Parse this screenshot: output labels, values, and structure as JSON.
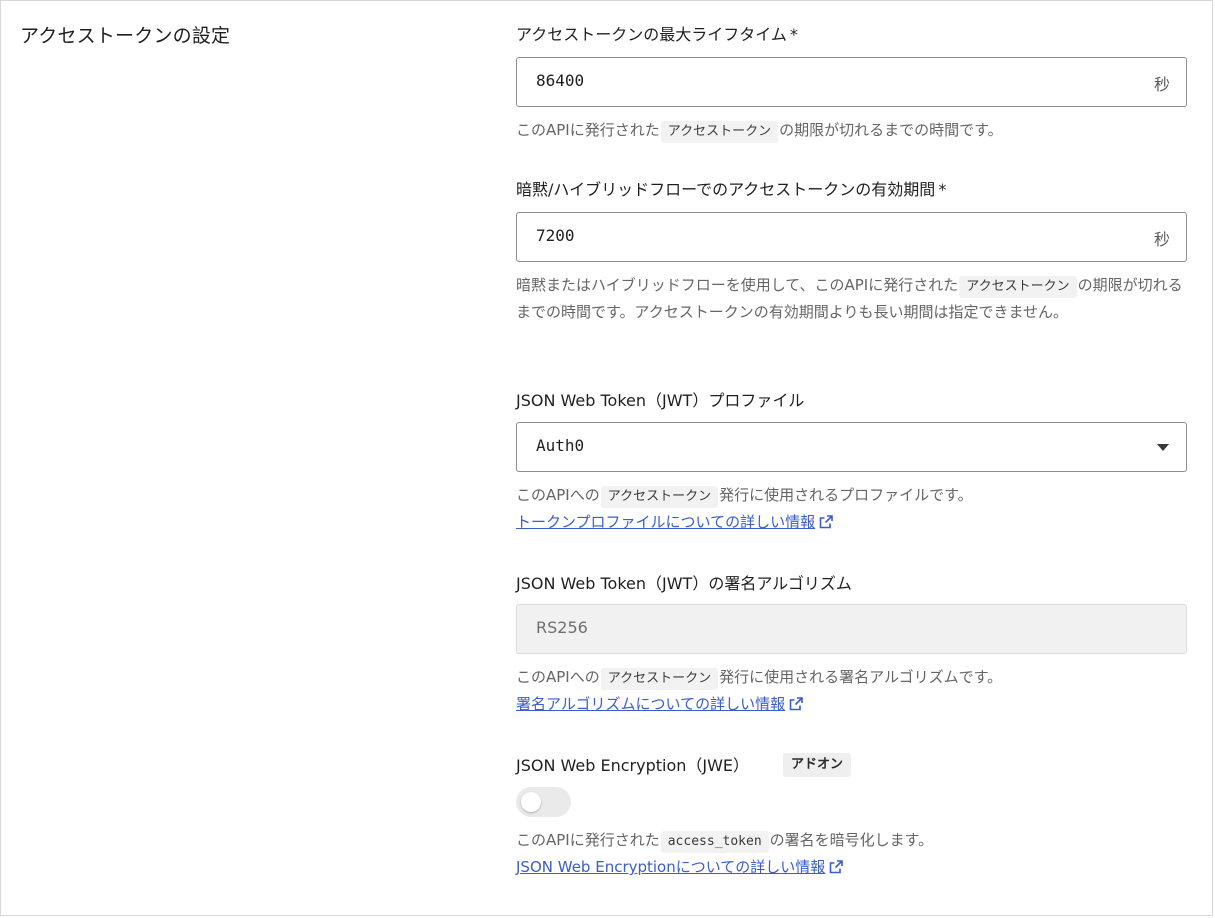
{
  "section": {
    "title": "アクセストークンの設定"
  },
  "lifetime": {
    "label": "アクセストークンの最大ライフタイム",
    "required_mark": "*",
    "value": "86400",
    "unit": "秒",
    "help_before": "このAPIに発行された",
    "help_code": "アクセストークン",
    "help_after": "の期限が切れるまでの時間です。"
  },
  "implicit": {
    "label": "暗黙/ハイブリッドフローでのアクセストークンの有効期間",
    "required_mark": "*",
    "value": "7200",
    "unit": "秒",
    "help_before": "暗黙またはハイブリッドフローを使用して、このAPIに発行された",
    "help_code": "アクセストークン",
    "help_after": "の期限が切れるまでの時間です。アクセストークンの有効期間よりも長い期間は指定できません。"
  },
  "jwt_profile": {
    "label": "JSON Web Token（JWT）プロファイル",
    "selected": "Auth0",
    "help_before": "このAPIへの",
    "help_code": "アクセストークン",
    "help_after": "発行に使用されるプロファイルです。",
    "link": "トークンプロファイルについての詳しい情報"
  },
  "signing": {
    "label": "JSON Web Token（JWT）の署名アルゴリズム",
    "value": "RS256",
    "help_before": "このAPIへの",
    "help_code": "アクセストークン",
    "help_after": "発行に使用される署名アルゴリズムです。",
    "link": "署名アルゴリズムについての詳しい情報"
  },
  "jwe": {
    "label": "JSON Web Encryption（JWE）",
    "badge": "アドオン",
    "enabled": false,
    "help_before": "このAPIに発行された",
    "help_code": "access_token",
    "help_after": "の署名を暗号化します。",
    "link": "JSON Web Encryptionについての詳しい情報"
  },
  "colors": {
    "link": "#3a5ccc",
    "border": "#8e8e8e",
    "help_text": "#656565"
  }
}
